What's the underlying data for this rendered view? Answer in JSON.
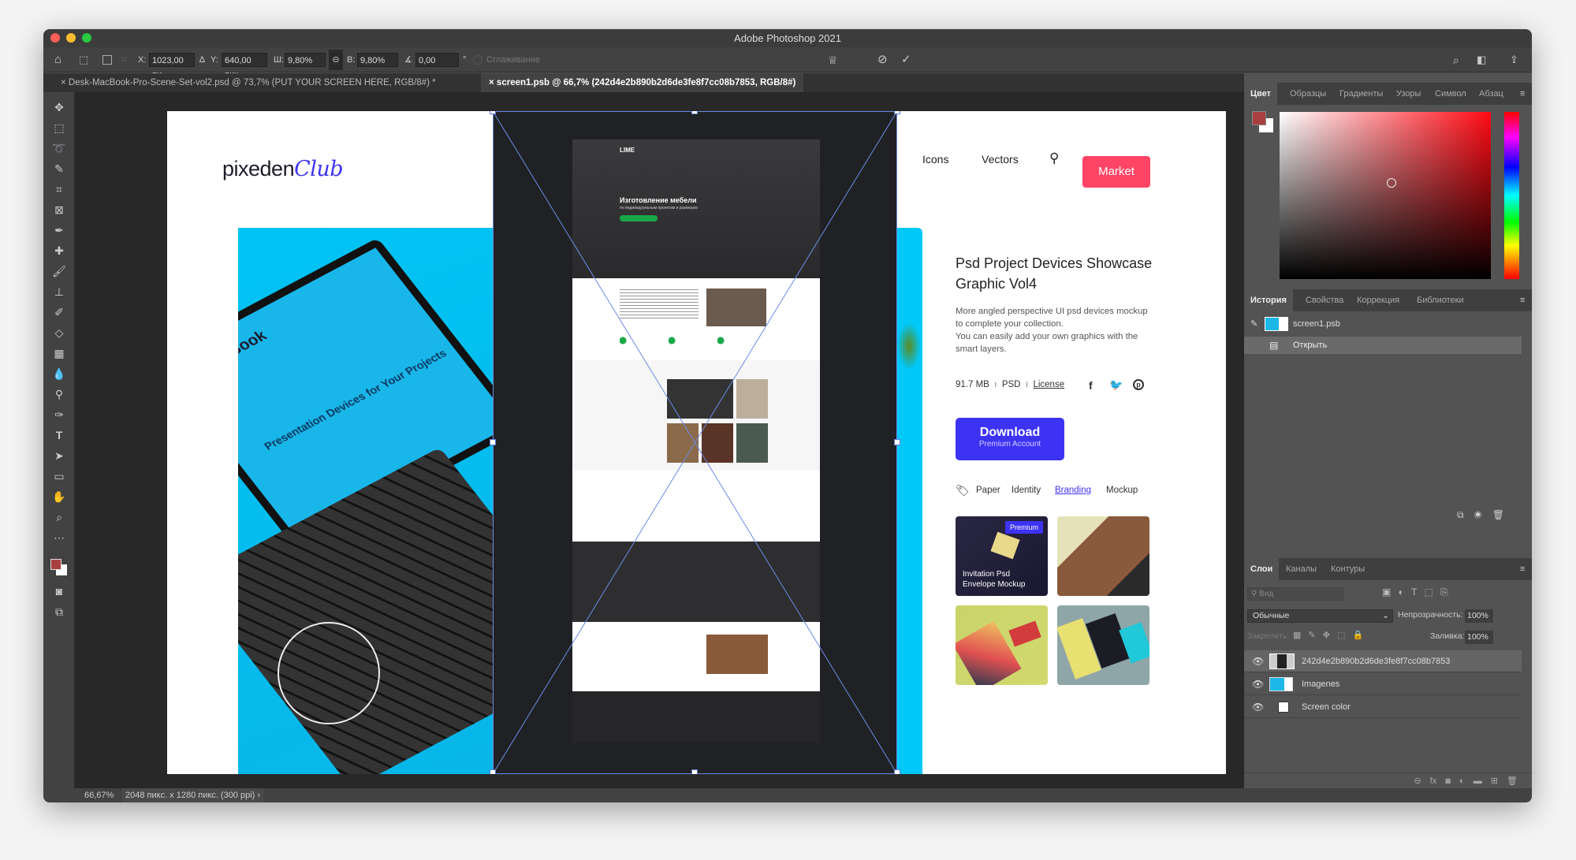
{
  "app": {
    "title": "Adobe Photoshop 2021"
  },
  "options": {
    "x_label": "X:",
    "x": "1023,00 пи",
    "y_label": "Y:",
    "y": "640,00 пик",
    "w_label": "Ш:",
    "w": "9,80%",
    "h_label": "В:",
    "h": "9,80%",
    "angle": "0,00",
    "angle_unit": "°",
    "antialias": "Сглаживание"
  },
  "tabs": [
    {
      "label": "Desk-MacBook-Pro-Scene-Set-vol2.psd @ 73,7% (PUT YOUR SCREEN HERE, RGB/8#) *",
      "active": false
    },
    {
      "label": "screen1.psb @ 66,7% (242d4e2b890b2d6de3fe8f7cc08b7853, RGB/8#)",
      "active": true
    }
  ],
  "document": {
    "logo": "pixedenClub",
    "nav": [
      "Icons",
      "Vectors"
    ],
    "market": "Market",
    "title": "Psd Project Devices Showcase Graphic Vol4",
    "description": [
      "More angled perspective UI psd devices mockup to complete your collection.",
      "You can easily add your own graphics with the smart layers."
    ],
    "size": "91.7 MB",
    "format": "PSD",
    "license": "License",
    "download": "Download",
    "download_sub": "Premium Account",
    "tags": [
      "Paper",
      "Identity",
      "Branding",
      "Mockup"
    ],
    "thumbnails": [
      {
        "badge": "Premium",
        "caption": "Invitation Psd Envelope Mockup"
      },
      {
        "caption": ""
      },
      {
        "caption": ""
      },
      {
        "caption": ""
      }
    ],
    "laptop_text": "Presentation Devices for Your Projects",
    "laptop_brand": "MacBook",
    "site": {
      "logo": "LIME",
      "headline": "Изготовление мебели",
      "subhead": "по индивидуальным проектам и размерам"
    },
    "colors": {
      "market": "#ff4466",
      "download": "#3d33f5",
      "cyan": "#00c8f8",
      "branding": "#3d33f5"
    }
  },
  "color_panel": {
    "tabs": [
      "Цвет",
      "Образцы",
      "Градиенты",
      "Узоры",
      "Символ",
      "Абзац"
    ],
    "foreground": "#a84040",
    "background": "#ffffff"
  },
  "history_panel": {
    "tabs": [
      "История",
      "Свойства",
      "Коррекция",
      "Библиотеки"
    ],
    "items": [
      "screen1.psb",
      "Открыть"
    ]
  },
  "layers_panel": {
    "tabs": [
      "Слои",
      "Каналы",
      "Контуры"
    ],
    "filter_placeholder": "Вид",
    "blend": "Обычные",
    "opacity_label": "Непрозрачность:",
    "opacity": "100%",
    "lock_label": "Закрепить:",
    "fill_label": "Заливка:",
    "fill": "100%",
    "layers": [
      {
        "name": "242d4e2b890b2d6de3fe8f7cc08b7853",
        "selected": true
      },
      {
        "name": "Imagenes",
        "selected": false
      },
      {
        "name": "Screen color",
        "selected": false
      }
    ]
  },
  "status": {
    "zoom": "66,67%",
    "info": "2048 пикс. x 1280 пикс. (300 ppi)"
  }
}
